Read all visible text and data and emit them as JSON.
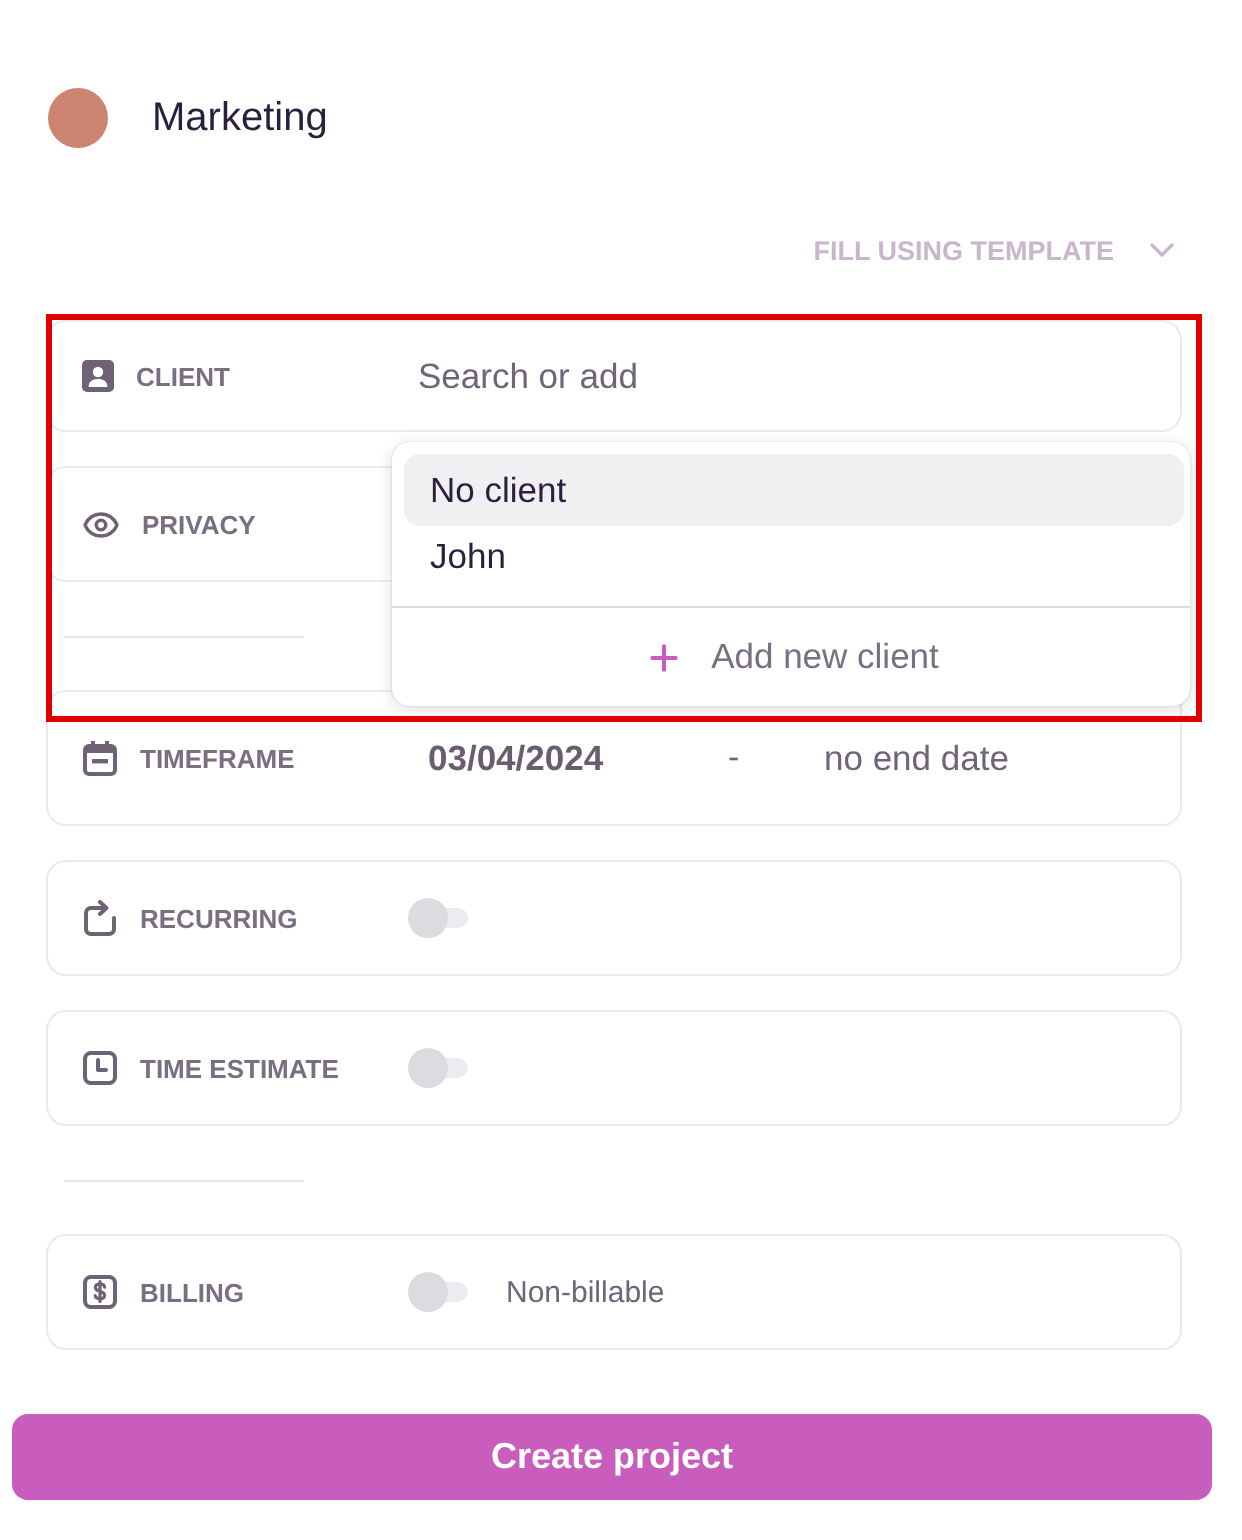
{
  "project": {
    "name": "Marketing",
    "color": "#cc8470"
  },
  "template_button": {
    "label": "FILL USING TEMPLATE",
    "disabled": true
  },
  "sections": [
    {
      "fields": [
        {
          "kind": "client",
          "label": "CLIENT",
          "placeholder": "Search or add",
          "dropdown": {
            "options": [
              {
                "label": "No client",
                "selected": true
              },
              {
                "label": "John",
                "selected": false
              }
            ],
            "add_label": "Add new client"
          }
        },
        {
          "kind": "privacy",
          "label": "PRIVACY"
        }
      ]
    },
    {
      "fields": [
        {
          "kind": "timeframe",
          "label": "TIMEFRAME",
          "start": "03/04/2024",
          "separator": "-",
          "end": "no end date"
        },
        {
          "kind": "recurring",
          "label": "RECURRING",
          "on": false
        },
        {
          "kind": "estimate",
          "label": "TIME ESTIMATE",
          "on": false
        }
      ]
    },
    {
      "fields": [
        {
          "kind": "billing",
          "label": "BILLING",
          "on": false,
          "value": "Non-billable"
        }
      ]
    }
  ],
  "submit_button": {
    "label": "Create project"
  }
}
